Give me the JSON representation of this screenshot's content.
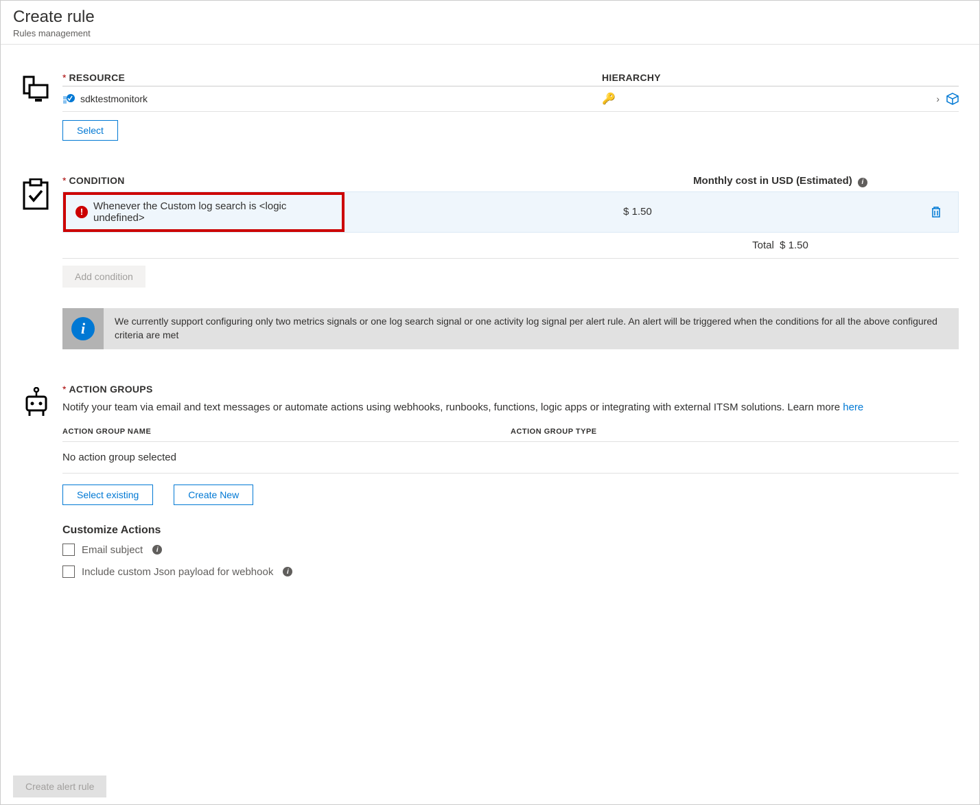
{
  "header": {
    "title": "Create rule",
    "subtitle": "Rules management"
  },
  "resource": {
    "label": "RESOURCE",
    "hierarchy_label": "HIERARCHY",
    "name": "sdktestmonitork",
    "select_button": "Select"
  },
  "condition": {
    "label": "CONDITION",
    "cost_label": "Monthly cost in USD (Estimated)",
    "condition_text": "Whenever the Custom log search is <logic undefined>",
    "cost_value": "$ 1.50",
    "total_label": "Total",
    "total_value": "$ 1.50",
    "add_button": "Add condition",
    "info_text": "We currently support configuring only two metrics signals or one log search signal or one activity log signal per alert rule. An alert will be triggered when the conditions for all the above configured criteria are met"
  },
  "action_groups": {
    "label": "ACTION GROUPS",
    "desc_prefix": "Notify your team via email and text messages or automate actions using webhooks, runbooks, functions, logic apps or integrating with external ITSM solutions. Learn more ",
    "desc_link": "here",
    "col_name": "ACTION GROUP NAME",
    "col_type": "ACTION GROUP TYPE",
    "empty_text": "No action group selected",
    "select_existing": "Select existing",
    "create_new": "Create New",
    "customize_title": "Customize Actions",
    "email_subject": "Email subject",
    "json_payload": "Include custom Json payload for webhook"
  },
  "footer": {
    "create_button": "Create alert rule"
  }
}
